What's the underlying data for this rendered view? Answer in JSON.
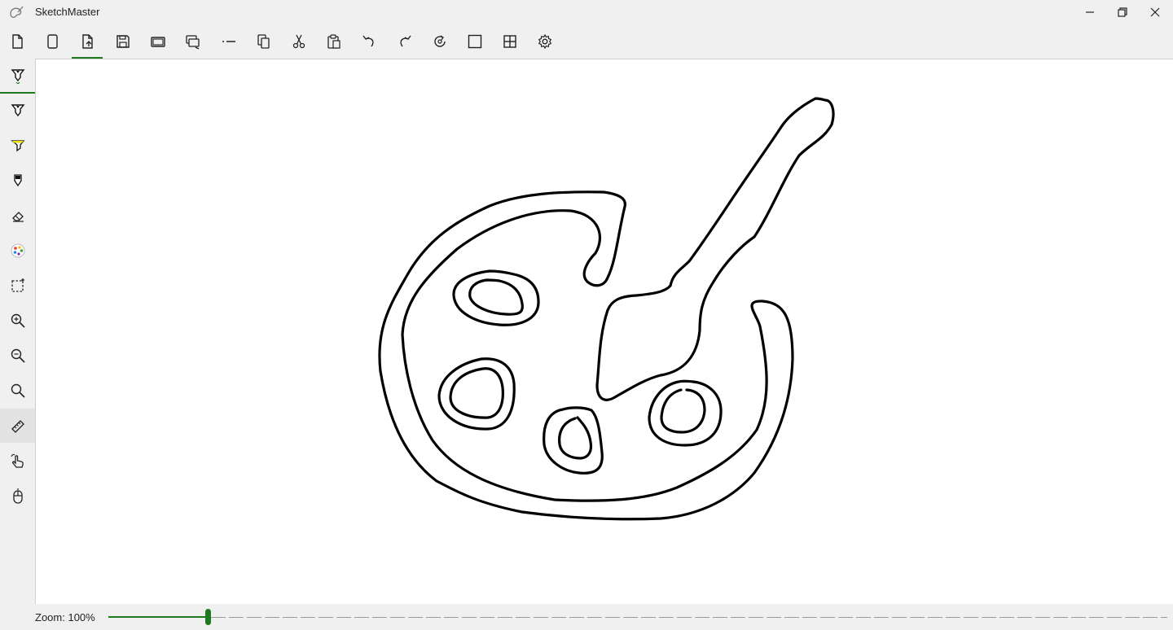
{
  "app": {
    "title": "SketchMaster"
  },
  "window_controls": [
    {
      "name": "minimize-button",
      "icon": "minimize-icon"
    },
    {
      "name": "restore-button",
      "icon": "restore-icon"
    },
    {
      "name": "close-button",
      "icon": "close-icon"
    }
  ],
  "toolbar": {
    "active": "new-page-button",
    "items": [
      {
        "name": "new-file-button",
        "icon": "new-file-icon"
      },
      {
        "name": "blank-page-button",
        "icon": "blank-page-icon"
      },
      {
        "name": "new-page-button",
        "icon": "new-page-icon"
      },
      {
        "name": "save-button",
        "icon": "save-icon"
      },
      {
        "name": "save-as-button",
        "icon": "save-as-icon"
      },
      {
        "name": "export-button",
        "icon": "export-icon"
      },
      {
        "name": "line-style-button",
        "icon": "line-style-icon"
      },
      {
        "name": "copy-button",
        "icon": "copy-icon"
      },
      {
        "name": "cut-button",
        "icon": "cut-icon"
      },
      {
        "name": "paste-button",
        "icon": "paste-icon"
      },
      {
        "name": "undo-button",
        "icon": "undo-icon"
      },
      {
        "name": "redo-button",
        "icon": "redo-icon"
      },
      {
        "name": "rotate-button",
        "icon": "rotate-icon"
      },
      {
        "name": "rectangle-button",
        "icon": "rectangle-icon"
      },
      {
        "name": "grid-button",
        "icon": "grid-icon"
      },
      {
        "name": "settings-button",
        "icon": "gear-icon"
      }
    ]
  },
  "sidebar": {
    "selected": "ruler-tool",
    "items": [
      {
        "name": "pen-dropdown",
        "icon": "pen-icon"
      },
      {
        "name": "pen-tool",
        "icon": "pen-icon"
      },
      {
        "name": "highlighter-tool",
        "icon": "highlighter-icon"
      },
      {
        "name": "pencil-tool",
        "icon": "pencil-icon"
      },
      {
        "name": "eraser-tool",
        "icon": "eraser-icon"
      },
      {
        "name": "color-palette-tool",
        "icon": "palette-icon"
      },
      {
        "name": "selection-tool",
        "icon": "selection-icon"
      },
      {
        "name": "zoom-in-tool",
        "icon": "zoom-in-icon"
      },
      {
        "name": "zoom-out-tool",
        "icon": "zoom-out-icon"
      },
      {
        "name": "zoom-reset-tool",
        "icon": "search-icon"
      },
      {
        "name": "ruler-tool",
        "icon": "ruler-icon"
      },
      {
        "name": "touch-draw-tool",
        "icon": "touch-icon"
      },
      {
        "name": "mouse-draw-tool",
        "icon": "mouse-icon"
      }
    ]
  },
  "colors": {
    "accent": "#1f7a1f",
    "highlighter": "#e8e000",
    "ink": "#000000"
  },
  "status": {
    "zoom_prefix": "Zoom:",
    "zoom_value": "100%",
    "zoom_level": 0.094
  }
}
